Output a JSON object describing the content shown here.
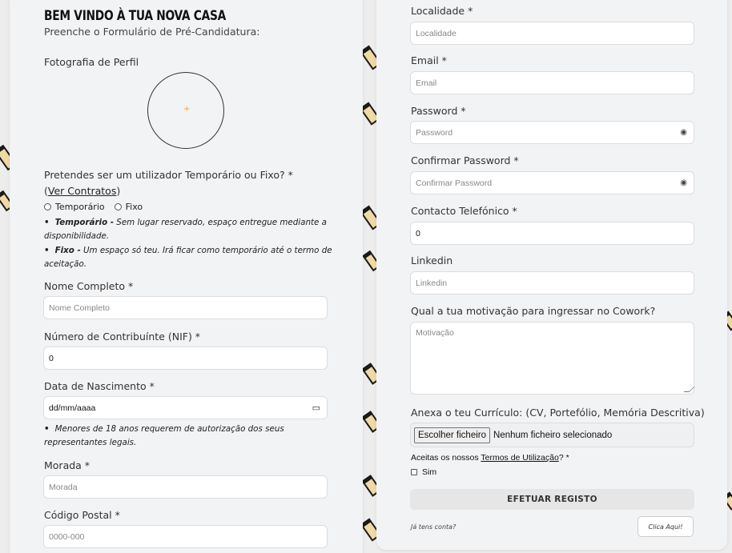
{
  "left_form": {
    "title": "BEM VINDO À TUA NOVA CASA",
    "subtitle": "Preenche o Formulário de Pré-Candidatura:",
    "photo_label": "Fotografia de Perfil",
    "photo_placeholder": "+",
    "user_type_question": "Pretendes ser um utilizador Temporário ou Fixo? * (",
    "contracts_link": "Ver Contratos",
    "question_close": ")",
    "radio_temporary": "Temporário",
    "radio_fixed": "Fixo",
    "note_temporary_term": "Temporário -",
    "note_temporary_text": " Sem lugar reservado, espaço entregue mediante a disponibilidade.",
    "note_fixed_term": "Fixo -",
    "note_fixed_text": " Um espaço só teu. Irá ficar como temporário até o termo de aceitação.",
    "full_name_label": "Nome Completo *",
    "full_name_placeholder": "Nome Completo",
    "nif_label": "Número de Contribuínte (NIF) *",
    "nif_value": "0",
    "birth_label": "Data de Nascimento *",
    "birth_value": "dd/mm/aaaa",
    "birth_note": "Menores de 18 anos requerem de autorização dos seus representantes legais.",
    "address_label": "Morada *",
    "address_placeholder": "Morada",
    "postal_label": "Código Postal *",
    "postal_placeholder": "0000-000"
  },
  "right_form": {
    "locality_label": "Localidade *",
    "locality_placeholder": "Localidade",
    "email_label": "Email *",
    "email_placeholder": "Email",
    "password_label": "Password *",
    "password_placeholder": "Password",
    "confirm_label": "Confirmar Password *",
    "confirm_placeholder": "Confirmar Password",
    "phone_label": "Contacto Telefónico *",
    "phone_value": "0",
    "linkedin_label": "Linkedin",
    "linkedin_placeholder": "Linkedin",
    "motivation_label": "Qual a tua motivação para ingressar no Cowork?",
    "motivation_placeholder": "Motivação",
    "cv_label": "Anexa o teu Currículo: (CV, Portefólio, Memória Descritiva)",
    "file_button": "Escolher ficheiro",
    "file_status": "Nenhum ficheiro selecionado",
    "terms_prefix": "Aceitas os nossos ",
    "terms_link": "Termos de Utilização",
    "terms_suffix": "? *",
    "terms_checkbox": "Sim",
    "submit_label": "EFETUAR REGISTO",
    "have_account": "Já tens conta?",
    "login_button": "Clica Aqui!"
  },
  "icons": {
    "eye": "eye-icon",
    "calendar": "calendar-icon"
  },
  "colors": {
    "accent_stripe": "#efd9a4",
    "card_bg": "#f2f3f5",
    "page_bg": "#ededed"
  }
}
